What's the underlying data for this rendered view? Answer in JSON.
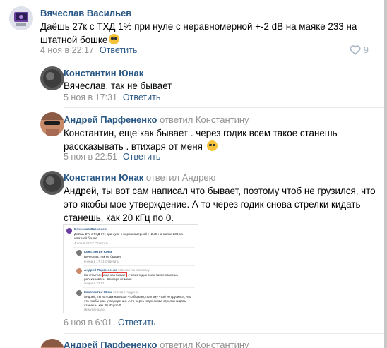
{
  "comments": [
    {
      "author": "Вячеслав Васильев",
      "reply_to": "",
      "lines": [
        "Даёшь 27к с ТХД 1% при нуле с неравномерной +-2 dB на маяке 233 на",
        "штатной бошке"
      ],
      "date": "4 ноя в 22:17",
      "reply_label": "Ответить",
      "likes": "9"
    },
    {
      "author": "Константин Юнак",
      "reply_to": "",
      "lines": [
        "Вячеслав, так не бывает"
      ],
      "date": "5 ноя в 17:31",
      "reply_label": "Ответить"
    },
    {
      "author": "Андрей Парфененко",
      "reply_to": "ответил Константину",
      "lines": [
        "Константин, еще как бывает . через годик всем такое станешь",
        "рассказывать . втихаря от меня"
      ],
      "date": "5 ноя в 22:51",
      "reply_label": "Ответить"
    },
    {
      "author": "Константин Юнак",
      "reply_to": "ответил Андрею",
      "lines": [
        "Андрей, ты вот сам написал что бывает, поэтому чтоб не грузился, что",
        "это якобы мое утверждение. А то через годик снова стрелки кидать",
        "станешь, как 20 кГц по 0."
      ],
      "date": "6 ноя в 6:01",
      "reply_label": "Ответить"
    },
    {
      "author": "Андрей Парфененко",
      "reply_to": "ответил Константину"
    }
  ],
  "embedded_shot": {
    "c1_name": "Вячеслав Васильев",
    "c1_l1": "Даёшь 27к с ТХД 1% при нуле с неравномерной +-2 dB на маяке 233 на",
    "c1_l2": "штатной бошке",
    "c1_meta": "4 ноя в 22:17 Ответить",
    "c2_name": "Константин Юнак",
    "c2_l1": "Вячеслав, так не бывает",
    "c2_meta": "вчера в 17:31 Ответить",
    "c3_name": "Андрей Парфененко",
    "c3_reply": "ответил Константину",
    "c3_l1a": "Константин,",
    "c3_l1b": "еще как бывает",
    "c3_l1c": ". через годик всем такое станешь",
    "c3_l2": "рассказывать . втихаря от меня",
    "c3_meta": "вчера в 22:51",
    "c4_name": "Константин Юнак",
    "c4_reply": "ответил Андрею",
    "c4_l1": "Андрей, ты вот сам написал что бывает, поэтому чтоб не грузился, что",
    "c4_l2": "это якобы мое утверждение. А то через годик снова стрелки кидать",
    "c4_l3": "станешь, как 20 кГц по 0.",
    "c4_meta": "минуту назад"
  }
}
